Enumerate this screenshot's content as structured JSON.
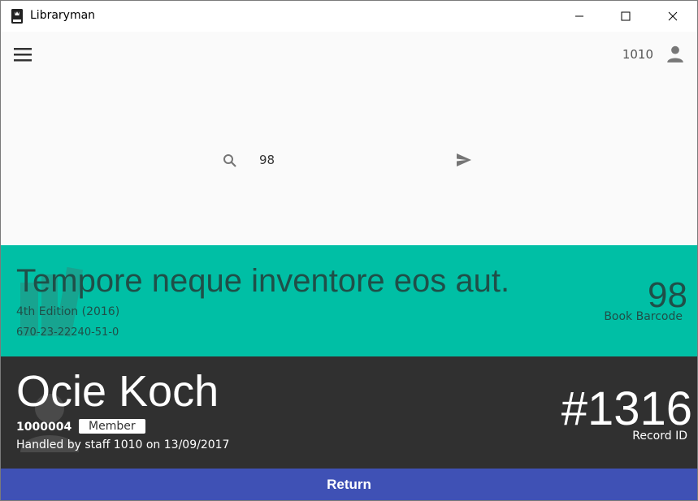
{
  "window": {
    "title": "Libraryman"
  },
  "appbar": {
    "user_id": "1010"
  },
  "search": {
    "value": "98"
  },
  "book": {
    "title": "Tempore neque inventore eos aut.",
    "edition": "4th Edition (2016)",
    "isbn": "670-23-22240-51-0",
    "barcode": "98",
    "barcode_label": "Book Barcode"
  },
  "member": {
    "name": "Ocie Koch",
    "id": "1000004",
    "role": "Member",
    "handled_by": "Handled by staff 1010 on 13/09/2017"
  },
  "record": {
    "id": "#1316",
    "label": "Record ID"
  },
  "actions": {
    "return_label": "Return"
  },
  "colors": {
    "book_panel": "#00bfa5",
    "member_panel": "#303030",
    "return_button": "#3f51b5"
  },
  "icons": {
    "app": "book-icon",
    "menu": "hamburger-menu-icon",
    "account": "account-icon",
    "search": "search-icon",
    "send": "send-icon"
  }
}
